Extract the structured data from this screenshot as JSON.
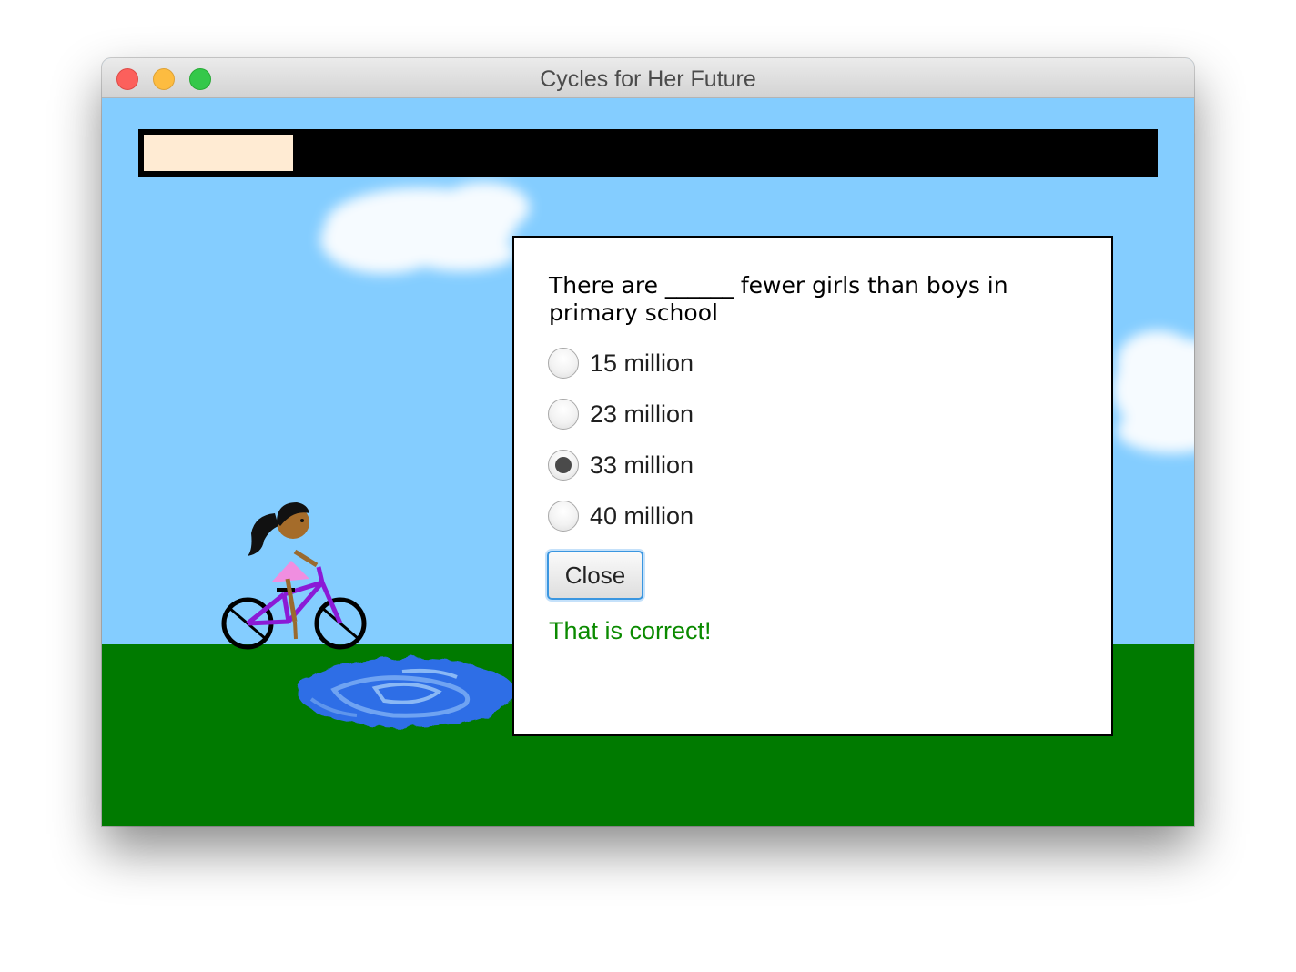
{
  "window": {
    "title": "Cycles for Her Future"
  },
  "progress": {
    "fraction": 0.148,
    "track_color": "#000000",
    "fill_color": "#ffebd3"
  },
  "scene": {
    "sky_color": "#84cdff",
    "grass_color": "#007a00",
    "puddle_color": "#2e6ee6",
    "character": "girl-riding-purple-bicycle"
  },
  "quiz": {
    "question": "There are ______ fewer girls than boys in primary school",
    "options": [
      {
        "label": "15 million",
        "selected": false
      },
      {
        "label": "23 million",
        "selected": false
      },
      {
        "label": "33 million",
        "selected": true
      },
      {
        "label": "40 million",
        "selected": false
      }
    ],
    "close_label": "Close",
    "feedback": "That is correct!",
    "feedback_color": "#0b8a00"
  }
}
